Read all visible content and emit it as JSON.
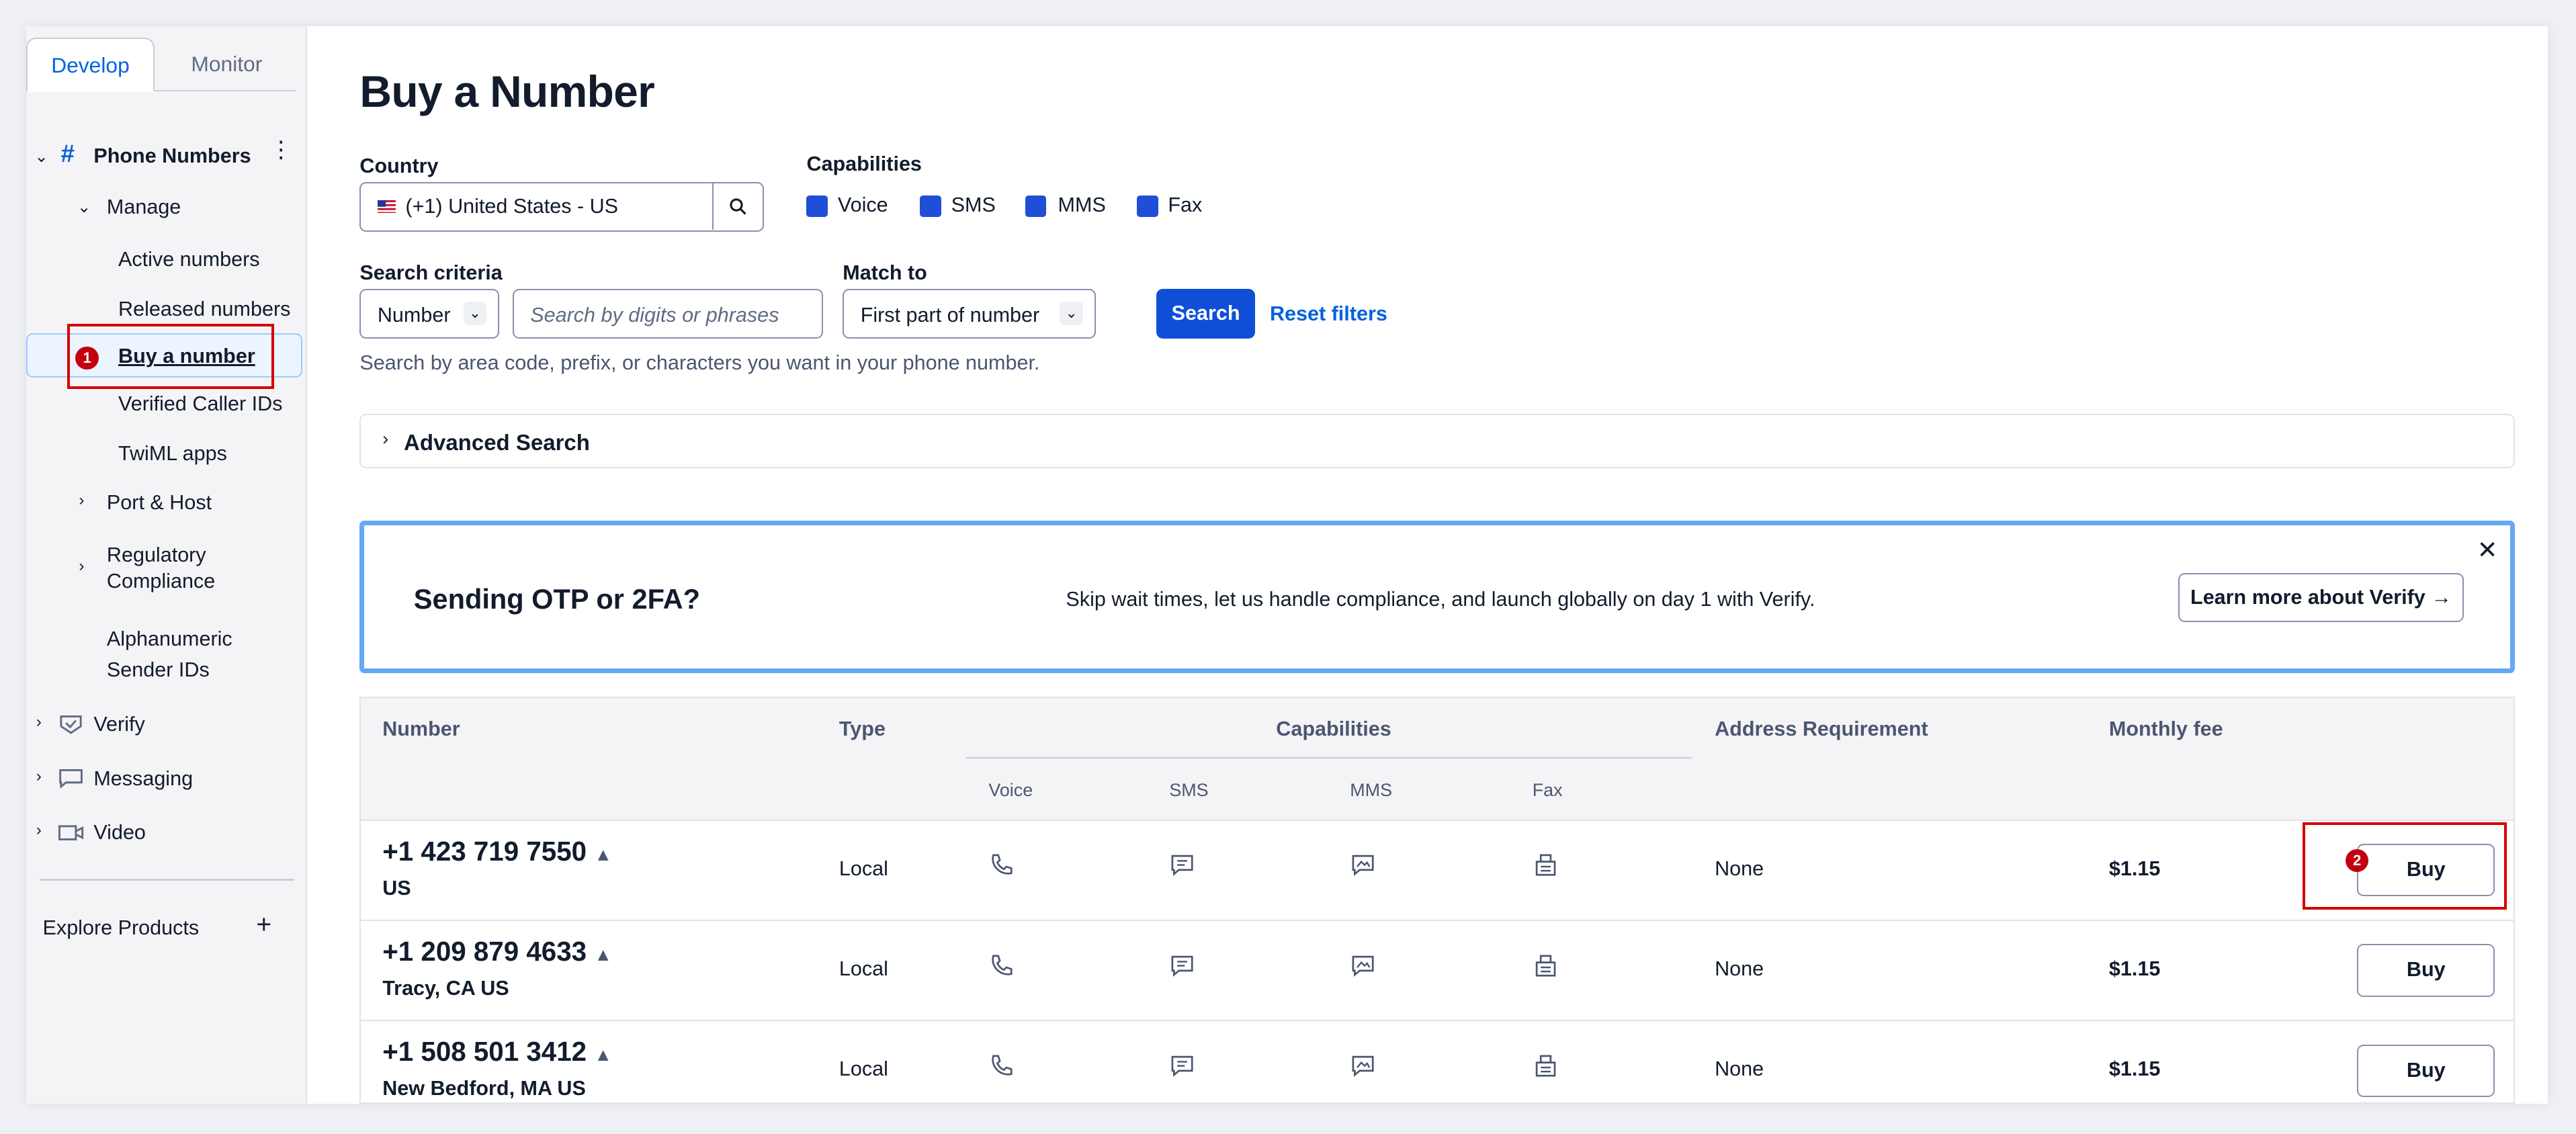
{
  "sidebar": {
    "tabs": [
      {
        "label": "Develop",
        "active": true
      },
      {
        "label": "Monitor",
        "active": false
      }
    ],
    "section_title": "Phone Numbers",
    "manage_label": "Manage",
    "manage_items": [
      {
        "label": "Active numbers"
      },
      {
        "label": "Released numbers"
      },
      {
        "label": "Buy a number",
        "active": true
      },
      {
        "label": "Verified Caller IDs"
      },
      {
        "label": "TwiML apps"
      }
    ],
    "port_host": "Port & Host",
    "regulatory_line1": "Regulatory",
    "regulatory_line2": "Compliance",
    "alpha_line1": "Alphanumeric",
    "alpha_line2": "Sender IDs",
    "products": [
      {
        "label": "Verify",
        "icon": "verify-icon"
      },
      {
        "label": "Messaging",
        "icon": "messaging-icon"
      },
      {
        "label": "Video",
        "icon": "video-icon"
      }
    ],
    "explore": "Explore Products"
  },
  "annotations": {
    "one": "1",
    "two": "2",
    "color": "#d60000"
  },
  "main": {
    "title": "Buy a Number",
    "country_label": "Country",
    "country_value": "(+1) United States - US",
    "capabilities_label": "Capabilities",
    "capabilities": [
      {
        "label": "Voice",
        "checked": true
      },
      {
        "label": "SMS",
        "checked": true
      },
      {
        "label": "MMS",
        "checked": true
      },
      {
        "label": "Fax",
        "checked": true
      }
    ],
    "search_criteria_label": "Search criteria",
    "search_criteria_value": "Number",
    "search_placeholder": "Search by digits or phrases",
    "match_to_label": "Match to",
    "match_to_value": "First part of number",
    "search_button": "Search",
    "reset_link": "Reset filters",
    "helper": "Search by area code, prefix, or characters you want in your phone number.",
    "advanced": "Advanced Search",
    "accent": "#0f4fd8"
  },
  "banner": {
    "title": "Sending OTP or 2FA?",
    "body": "Skip wait times, let us handle compliance, and launch globally on day 1 with Verify.",
    "button": "Learn more about Verify →",
    "close": "✕"
  },
  "table": {
    "headers": {
      "number": "Number",
      "type": "Type",
      "capabilities": "Capabilities",
      "address": "Address Requirement",
      "fee": "Monthly fee"
    },
    "sub_headers": [
      "Voice",
      "SMS",
      "MMS",
      "Fax"
    ],
    "rows": [
      {
        "number": "+1 423 719 7550",
        "location": "US",
        "type": "Local",
        "address": "None",
        "fee": "$1.15",
        "buy": "Buy"
      },
      {
        "number": "+1 209 879 4633",
        "location": "Tracy, CA US",
        "type": "Local",
        "address": "None",
        "fee": "$1.15",
        "buy": "Buy"
      },
      {
        "number": "+1 508 501 3412",
        "location": "New Bedford, MA US",
        "type": "Local",
        "address": "None",
        "fee": "$1.15",
        "buy": "Buy"
      }
    ]
  }
}
